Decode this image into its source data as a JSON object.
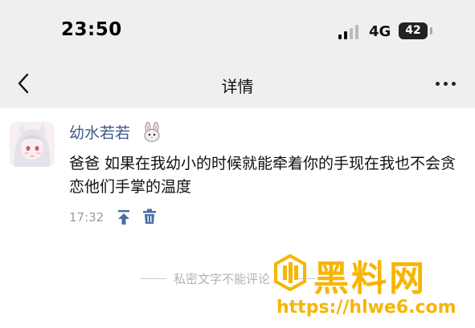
{
  "status_bar": {
    "time": "23:50",
    "network": "4G",
    "battery": "42"
  },
  "nav": {
    "title": "详情"
  },
  "post": {
    "username": "幼水若若",
    "username_icon": "rabbit-face-icon",
    "text": "爸爸 如果在我幼小的时候就能牵着你的手现在我也不会贪恋他们手掌的温度",
    "time": "17:32"
  },
  "footer_note": "私密文字不能评论",
  "watermark": {
    "title": "黑料网",
    "url": "https://hlwe6.com"
  },
  "colors": {
    "username": "#3e5a8c",
    "action_icon": "#4a6fa5",
    "watermark": "#f7b500",
    "top_background": "#efefef"
  }
}
